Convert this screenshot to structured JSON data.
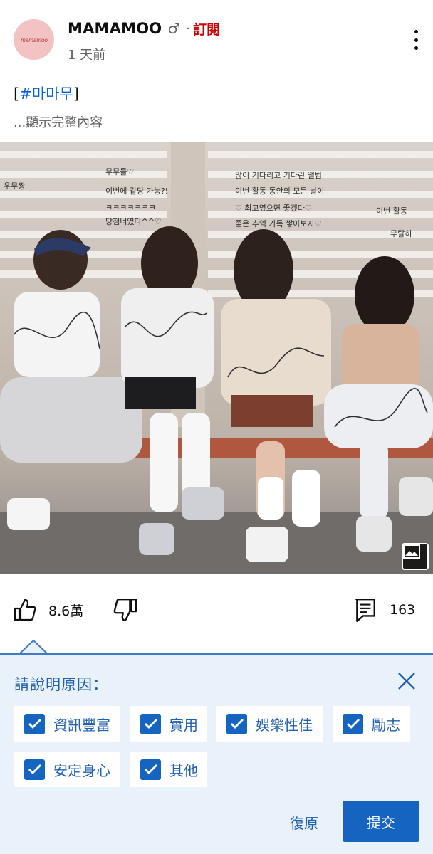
{
  "channel": {
    "name": "MAMAMOO",
    "music_note": "♂",
    "separator": "·",
    "subscribe_label": "訂閱",
    "timestamp": "1 天前",
    "avatar_icon": "mamamoo-logo-icon"
  },
  "post": {
    "hashtag_bracket_open": "[",
    "hashtag": "#마마무",
    "hashtag_bracket_close": "]",
    "show_more": "...顯示完整內容",
    "image_alt": "MAMAMOO group photo with autographs",
    "image_badge_icon": "image-gallery-icon"
  },
  "actions": {
    "like_count": "8.6萬",
    "comment_count": "163",
    "like_icon": "thumbs-up-icon",
    "dislike_icon": "thumbs-down-icon",
    "comment_icon": "comment-icon"
  },
  "feedback": {
    "title": "請說明原因：",
    "options": [
      {
        "label": "資訊豐富",
        "checked": true
      },
      {
        "label": "實用",
        "checked": true
      },
      {
        "label": "娛樂性佳",
        "checked": true
      },
      {
        "label": "勵志",
        "checked": true
      },
      {
        "label": "安定身心",
        "checked": true
      },
      {
        "label": "其他",
        "checked": true
      }
    ],
    "reset_label": "復原",
    "submit_label": "提交"
  },
  "colors": {
    "accent": "#1565c0",
    "panel_bg": "#e9f1fb",
    "link": "#065fd4",
    "subscribe": "#cc0000"
  }
}
